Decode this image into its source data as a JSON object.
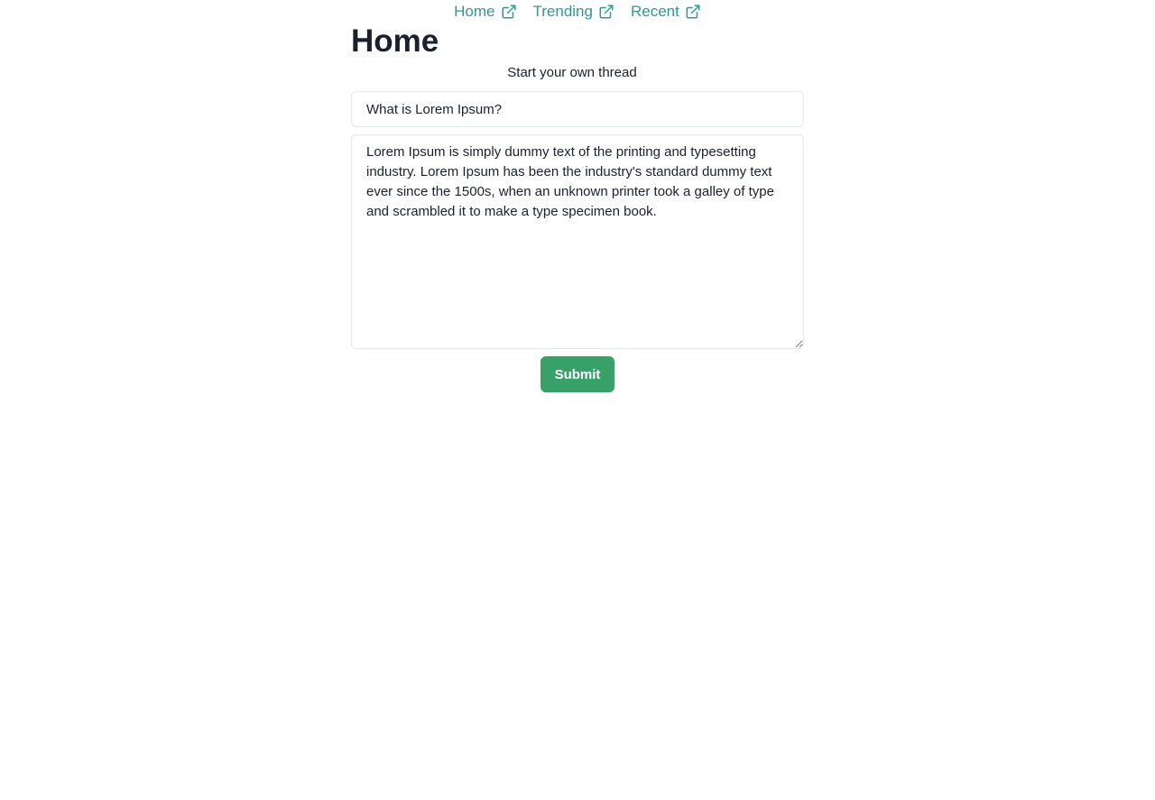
{
  "nav": {
    "items": [
      {
        "label": "Home",
        "icon": "external-link-icon"
      },
      {
        "label": "Trending",
        "icon": "external-link-icon"
      },
      {
        "label": "Recent",
        "icon": "external-link-icon"
      }
    ]
  },
  "page": {
    "title": "Home",
    "subtitle": "Start your own thread"
  },
  "form": {
    "title_value": "What is Lorem Ipsum?",
    "body_value": "Lorem Ipsum is simply dummy text of the printing and typesetting industry. Lorem Ipsum has been the industry's standard dummy text ever since the 1500s, when an unknown printer took a galley of type and scrambled it to make a type specimen book.",
    "submit_label": "Submit"
  },
  "colors": {
    "link": "#319795",
    "submit_bg": "#38a169",
    "text": "#1a202c",
    "border": "#e2e8f0"
  }
}
